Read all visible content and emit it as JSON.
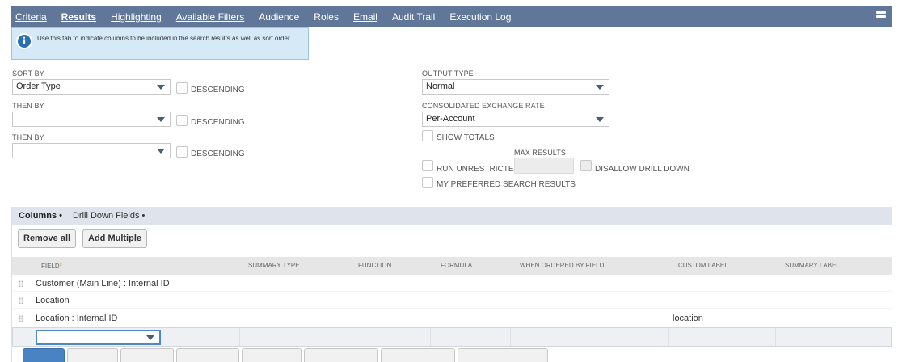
{
  "tabs": [
    {
      "label": "Criteria",
      "active": false,
      "underline": true
    },
    {
      "label": "Results",
      "active": true,
      "underline": true
    },
    {
      "label": "Highlighting",
      "active": false,
      "underline": true
    },
    {
      "label": "Available Filters",
      "active": false,
      "underline": true
    },
    {
      "label": "Audience",
      "active": false,
      "underline": false
    },
    {
      "label": "Roles",
      "active": false,
      "underline": false
    },
    {
      "label": "Email",
      "active": false,
      "underline": true
    },
    {
      "label": "Audit Trail",
      "active": false,
      "underline": false
    },
    {
      "label": "Execution Log",
      "active": false,
      "underline": false
    }
  ],
  "info": {
    "text": "Use this tab to indicate columns to be included in the search results as well as sort order."
  },
  "sort": {
    "sort_by_label": "SORT BY",
    "sort_by_value": "Order Type",
    "then_by_label_1": "THEN BY",
    "then_by_value_1": "",
    "then_by_label_2": "THEN BY",
    "then_by_value_2": "",
    "descending_label": "DESCENDING"
  },
  "output": {
    "output_type_label": "OUTPUT TYPE",
    "output_type_value": "Normal",
    "exchange_rate_label": "CONSOLIDATED EXCHANGE RATE",
    "exchange_rate_value": "Per-Account",
    "show_totals_label": "SHOW TOTALS",
    "max_results_label": "MAX RESULTS",
    "run_unrestricted_label": "RUN UNRESTRICTED",
    "disallow_drill_down_label": "DISALLOW DRILL DOWN",
    "preferred_results_label": "MY PREFERRED SEARCH RESULTS"
  },
  "subtabs": [
    {
      "label": "Columns •",
      "active": true
    },
    {
      "label": "Drill Down Fields •",
      "active": false
    }
  ],
  "buttons": {
    "remove_all": "Remove all",
    "add_multiple": "Add Multiple"
  },
  "table": {
    "headers": {
      "field": "FIELD",
      "required_mark": "*",
      "summary_type": "SUMMARY TYPE",
      "function": "FUNCTION",
      "formula": "FORMULA",
      "when_ordered": "WHEN ORDERED BY FIELD",
      "custom_label": "CUSTOM LABEL",
      "summary_label": "SUMMARY LABEL"
    },
    "rows": [
      {
        "field": "Customer (Main Line) : Internal ID",
        "custom_label": ""
      },
      {
        "field": "Location",
        "custom_label": ""
      },
      {
        "field": "Location : Internal ID",
        "custom_label": "location"
      }
    ]
  },
  "icons": {
    "info": "info-icon",
    "menu": "hamburger-menu-icon",
    "caret": "chevron-down-icon",
    "grip": "drag-handle-icon"
  },
  "colors": {
    "tabbar": "#607799",
    "info_bg": "#d5e9f7",
    "subtabbar": "#dfe4ec",
    "accent": "#4e88c7"
  }
}
